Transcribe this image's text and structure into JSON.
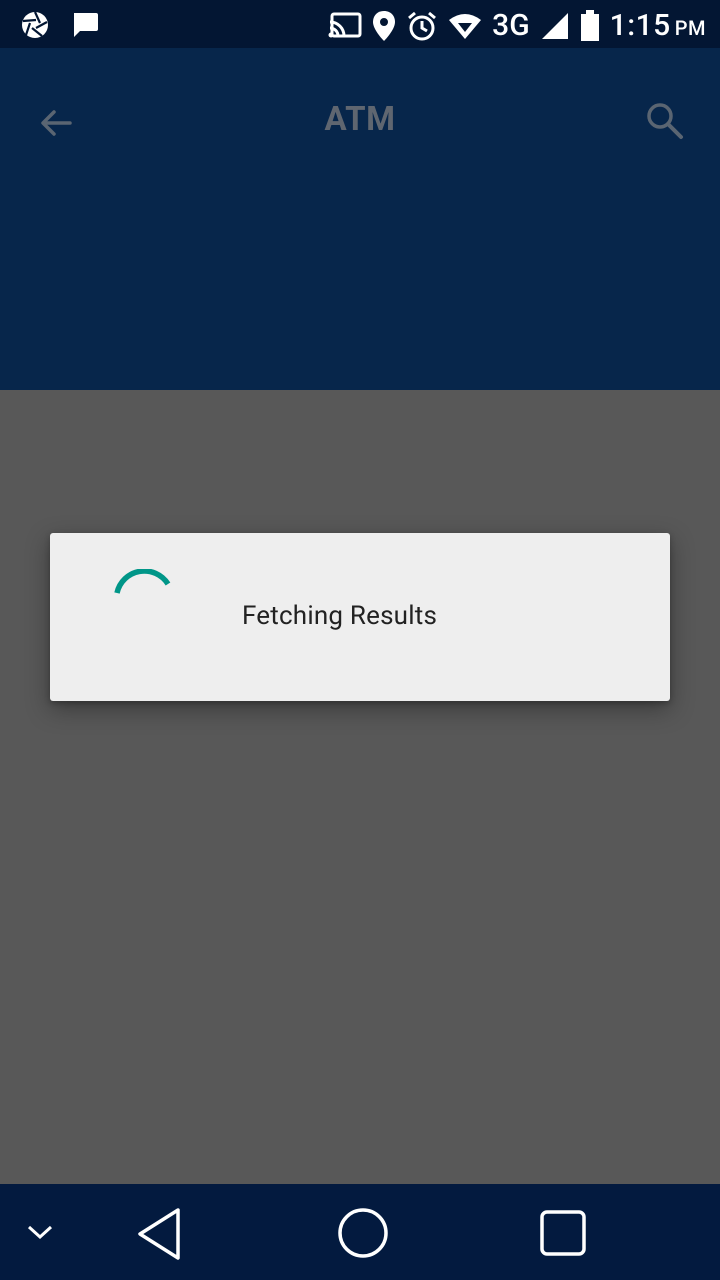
{
  "status_bar": {
    "network": "3G",
    "time": "1:15",
    "ampm": "PM",
    "icons": [
      "camera-aperture-icon",
      "chat-bubble-icon",
      "cast-icon",
      "location-pin-icon",
      "alarm-icon",
      "wifi-icon",
      "signal-icon",
      "battery-icon"
    ]
  },
  "app_bar": {
    "title": "ATM",
    "back_icon": "arrow-back-icon",
    "search_icon": "search-icon"
  },
  "dialog": {
    "message": "Fetching Results",
    "spinner_color": "#009688"
  },
  "nav_bar": {
    "items": [
      "chevron-down-icon",
      "back-triangle-icon",
      "home-circle-icon",
      "recents-square-icon"
    ]
  },
  "colors": {
    "status_bar": "#031633",
    "app_bar": "#07264b",
    "scrim": "#585858",
    "dialog_bg": "#eeeeee",
    "nav_bar": "#031a3f"
  }
}
